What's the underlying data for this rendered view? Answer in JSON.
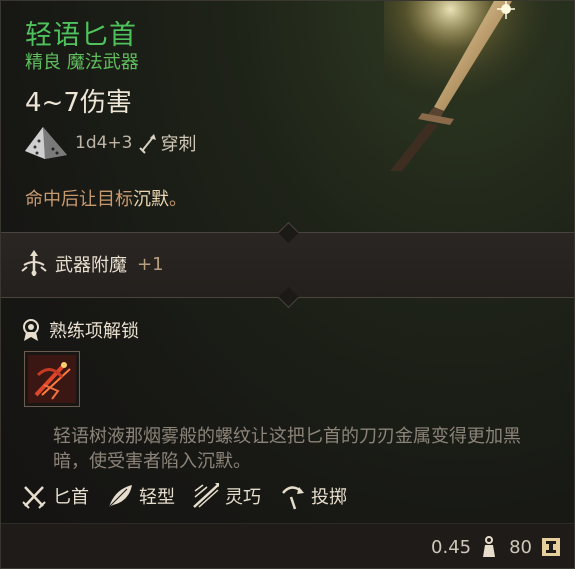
{
  "item": {
    "name": "轻语匕首",
    "rarity_type": "精良 魔法武器",
    "damage": "4~7伤害",
    "dice_roll": "1d4+3",
    "damage_type": "穿刺",
    "effect_prefix": "命中后让目标",
    "effect_keyword": "沉默",
    "effect_suffix": "。",
    "enchantment_label": "武器附魔",
    "enchantment_value": "+1",
    "proficiency_unlock_label": "熟练项解锁",
    "description": "轻语树液那烟雾般的螺纹让这把匕首的刀刃金属变得更加黑暗，使受害者陷入沉默。",
    "tags": [
      {
        "label": "匕首",
        "icon": "crossed-daggers-icon"
      },
      {
        "label": "轻型",
        "icon": "feather-icon"
      },
      {
        "label": "灵巧",
        "icon": "finesse-icon"
      },
      {
        "label": "投掷",
        "icon": "thrown-icon"
      }
    ],
    "weight": "0.45",
    "price": "80"
  },
  "colors": {
    "title": "#4ec25c",
    "subtitle": "#5fbf5e",
    "effect": "#c89a70",
    "keyword": "#ead6b0",
    "description": "#8c8478",
    "ability_glow": "#e0462a"
  }
}
